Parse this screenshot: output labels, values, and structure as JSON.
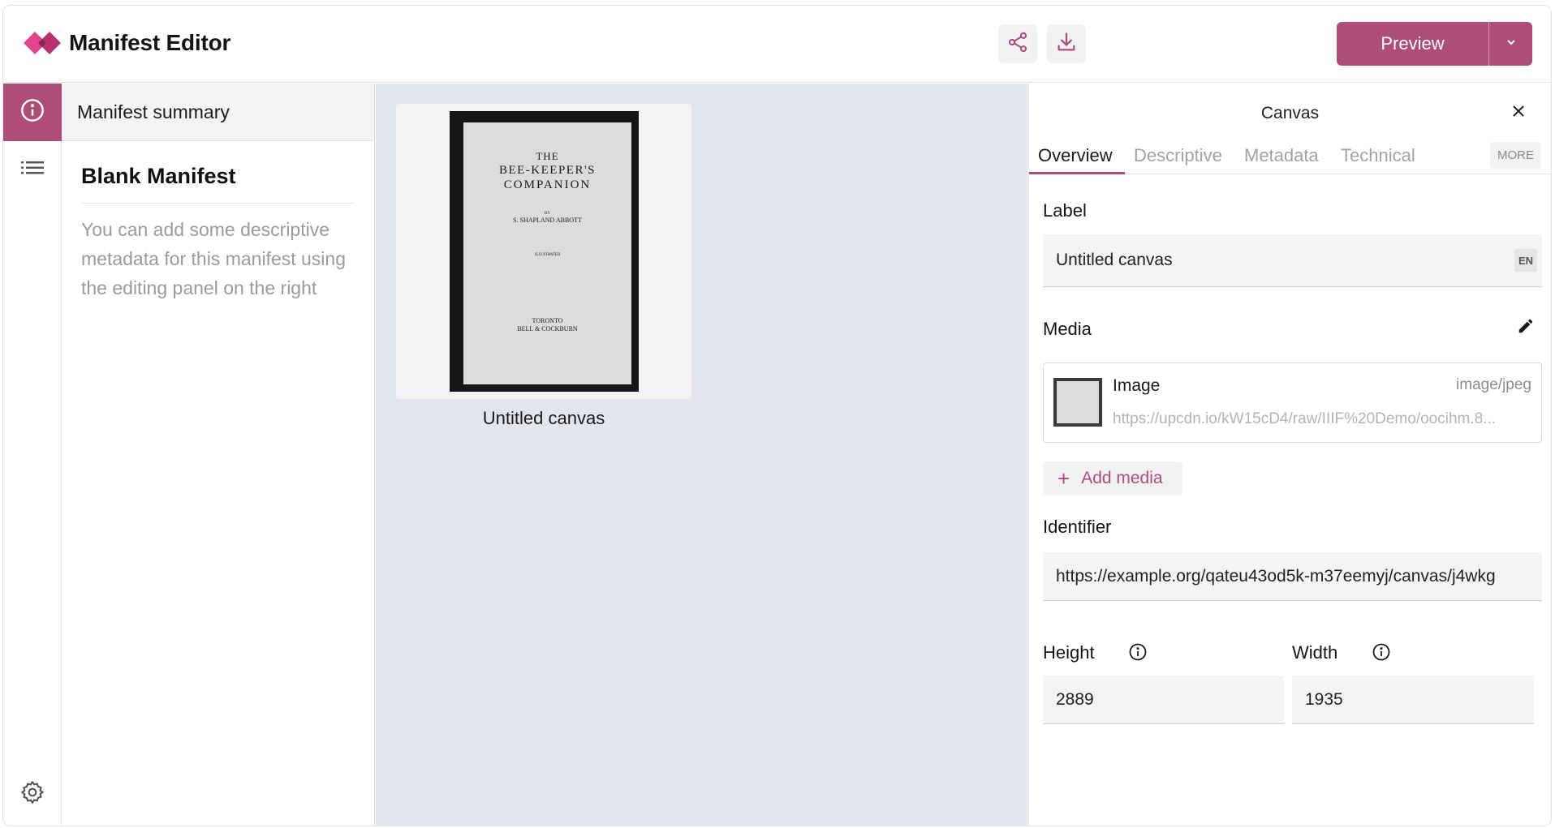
{
  "header": {
    "title": "Manifest Editor",
    "preview_label": "Preview"
  },
  "colors": {
    "accent": "#ad4e76",
    "canvas_bg": "#e3e6ef"
  },
  "icons": [
    "logo-icon",
    "share-icon",
    "download-icon",
    "chevron-down-icon",
    "info-icon",
    "list-icon",
    "gear-icon",
    "close-icon",
    "pencil-icon",
    "plus-icon"
  ],
  "summary": {
    "heading": "Manifest summary",
    "title": "Blank Manifest",
    "description": "You can add some descriptive metadata for this manifest using the editing panel on the right"
  },
  "canvas": {
    "thumbnail_label": "Untitled canvas",
    "book_page": {
      "line1": "THE",
      "line2": "BEE-KEEPER'S",
      "line3": "COMPANION",
      "by": "BY",
      "author": "S. SHAPLAND ABBOTT",
      "illustrated": "ILLUSTRATED",
      "city": "TORONTO",
      "publisher": "BELL & COCKBURN"
    }
  },
  "panel": {
    "title": "Canvas",
    "tabs": [
      "Overview",
      "Descriptive",
      "Metadata",
      "Technical"
    ],
    "more_label": "MORE",
    "label_heading": "Label",
    "label_value": "Untitled canvas",
    "label_lang": "EN",
    "media_heading": "Media",
    "media": {
      "name": "Image",
      "type": "image/jpeg",
      "url": "https://upcdn.io/kW15cD4/raw/IIIF%20Demo/oocihm.8..."
    },
    "add_media_label": "Add media",
    "identifier_heading": "Identifier",
    "identifier_value": "https://example.org/qateu43od5k-m37eemyj/canvas/j4wkg",
    "height_heading": "Height",
    "height_value": "2889",
    "width_heading": "Width",
    "width_value": "1935"
  }
}
